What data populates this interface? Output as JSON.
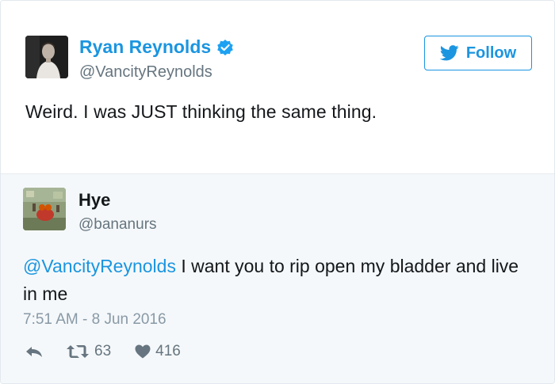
{
  "tweet": {
    "author_name": "Ryan Reynolds",
    "author_handle": "@VancityReynolds",
    "follow_label": "Follow",
    "text": "Weird. I was JUST thinking the same thing."
  },
  "reply": {
    "author_name": "Hye",
    "author_handle": "@bananurs",
    "mention": "@VancityReynolds",
    "text": " I want you to rip open my bladder and live in me",
    "timestamp": "7:51 AM - 8 Jun 2016",
    "retweet_count": "63",
    "like_count": "416"
  },
  "icons": {
    "verified": "verified-badge-icon",
    "bird": "twitter-bird-icon",
    "reply": "reply-arrow-icon",
    "retweet": "retweet-icon",
    "like": "heart-icon"
  },
  "colors": {
    "accent": "#1b95e0",
    "text": "#14171a",
    "muted": "#66757f",
    "reply_bg": "#f5f8fa"
  }
}
